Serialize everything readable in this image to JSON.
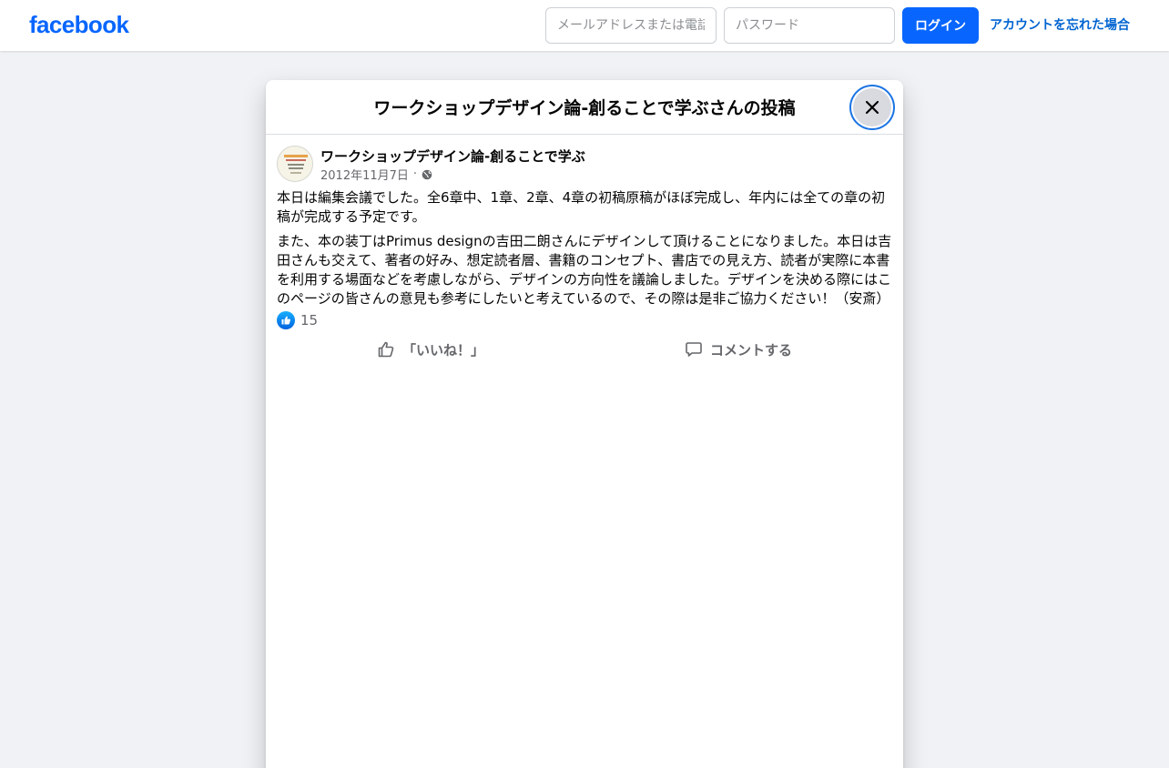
{
  "header": {
    "logo": "facebook",
    "email_placeholder": "メールアドレスまたは電話番号",
    "password_placeholder": "パスワード",
    "login_label": "ログイン",
    "forgot_label": "アカウントを忘れた場合"
  },
  "dialog": {
    "title": "ワークショップデザイン論-創ることで学ぶさんの投稿"
  },
  "post": {
    "author": "ワークショップデザイン論-創ることで学ぶ",
    "date": "2012年11月7日",
    "separator": "·",
    "paragraphs": [
      "本日は編集会議でした。全6章中、1章、2章、4章の初稿原稿がほぼ完成し、年内には全ての章の初稿が完成する予定です。",
      "また、本の装丁はPrimus designの吉田二朗さんにデザインして頂けることになりました。本日は吉田さんも交えて、著者の好み、想定読者層、書籍のコンセプト、書店での見え方、読者が実際に本書を利用する場面などを考慮しながら、デザインの方向性を議論しました。デザインを決める際にはこのページの皆さんの意見も参考にしたいと考えているので、その際は是非ご協力ください！（安斎）"
    ],
    "like_count": "15",
    "like_label": "「いいね！」",
    "comment_label": "コメントする"
  },
  "colors": {
    "brand": "#0866ff",
    "link": "#0064d1",
    "background": "#f0f2f5"
  }
}
